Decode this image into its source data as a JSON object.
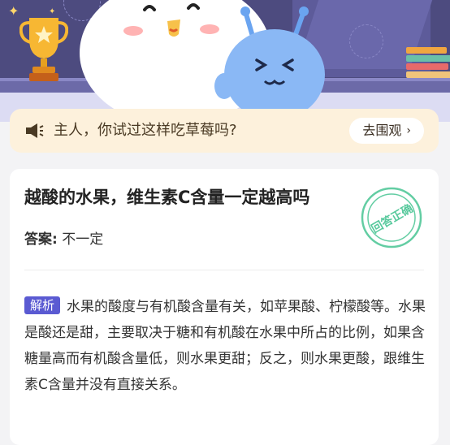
{
  "notice": {
    "text": "主人，你试过这样吃草莓吗?",
    "cta_label": "去围观",
    "chevron": "›"
  },
  "question": {
    "title": "越酸的水果，维生素C含量一定越高吗",
    "stamp_text": "回答正确",
    "answer_label": "答案:",
    "answer_value": "不一定"
  },
  "analysis": {
    "tag": "解析",
    "text": "水果的酸度与有机酸含量有关，如苹果酸、柠檬酸等。水果是酸还是甜，主要取决于糖和有机酸在水果中所占的比例，如果含糖量高而有机酸含量低，则水果更甜；反之，则水果更酸，跟维生素C含量并没有直接关系。"
  },
  "icons": {
    "trophy": "trophy-icon",
    "speaker": "speaker-icon",
    "stamp": "correct-stamp-icon"
  },
  "colors": {
    "banner_bg": "#4d4b7f",
    "notice_bg": "#fdf1dc",
    "tag_bg": "#5a5ad2",
    "stamp": "#3cc08c"
  }
}
